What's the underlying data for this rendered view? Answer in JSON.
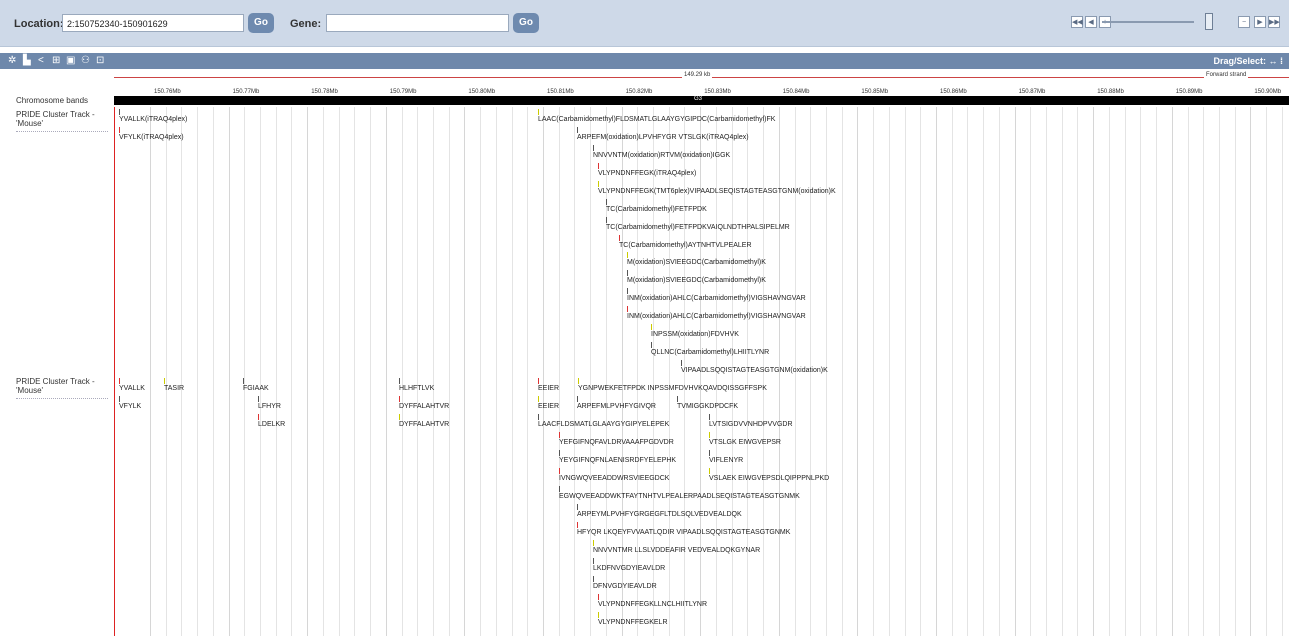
{
  "location": {
    "label": "Location:",
    "value": "2:150752340-150901629"
  },
  "gene": {
    "label": "Gene:",
    "value": ""
  },
  "go_label": "Go",
  "toolbar": {
    "drag_select": "Drag/Select: ↔ ⁞"
  },
  "ruler": {
    "span_label": "149.29 kb",
    "strand_label": "Forward strand",
    "ticks": [
      "150.76Mb",
      "150.77Mb",
      "150.78Mb",
      "150.79Mb",
      "150.80Mb",
      "150.81Mb",
      "150.82Mb",
      "150.83Mb",
      "150.84Mb",
      "150.85Mb",
      "150.86Mb",
      "150.87Mb",
      "150.88Mb",
      "150.89Mb",
      "150.90Mb"
    ]
  },
  "band": {
    "label": "Chromosome bands",
    "name": "G3"
  },
  "tracks": [
    {
      "label": "PRIDE Cluster Track - 'Mouse'"
    },
    {
      "label": "PRIDE Cluster Track - 'Mouse'"
    }
  ],
  "track1_features": [
    "YVALLK(iTRAQ4plex)",
    "VFYLK(iTRAQ4plex)",
    "LAAC(Carbamidomethyl)FLDSMATLGLAAYGYGIPDC(Carbamidomethyl)FK",
    "ARPEFM(oxidation)LPVHFYGR  VTSLGK(iTRAQ4plex)",
    "NNVVNTM(oxidation)RTVM(oxidation)IGGK",
    "VLYPNDNFFEGK(iTRAQ4plex)",
    "VLYPNDNFFEGK(TMT6plex)VIPAADLSEQISTAGTEASGTGNM(oxidation)K",
    "TC(Carbamidomethyl)FETFPDK",
    "TC(Carbamidomethyl)FETFPDKVAIQLNDTHPALSIPELMR",
    "TC(Carbamidomethyl)AYTNHTVLPEALER",
    "M(oxidation)SVIEEGDC(Carbamidomethyl)K",
    "M(oxidation)SVIEEGDC(Carbamidomethyl)K",
    "INM(oxidation)AHLC(Carbamidomethyl)VIGSHAVNGVAR",
    "INM(oxidation)AHLC(Carbamidomethyl)VIGSHAVNGVAR",
    "INPSSM(oxidation)FDVHVK",
    "QLLNC(Carbamidomethyl)LHIITLYNR",
    "VIPAADLSQQISTAGTEASGTGNM(oxidation)K"
  ],
  "track2_features": [
    "YVALLK",
    "TASIR",
    "FGIAAK",
    "HLHFTLVK",
    "EEIER",
    "YGNPWEKFETFPDK INPSSMFDVHVKQAVDQISSGFFSPK",
    "VFYLK",
    "LFHYR",
    "DYFFALAHTVR",
    "EEIER",
    "ARPEFMLPVHFYGIVQR",
    "TVMIGGKDPDCFK",
    "LDELKR",
    "DYFFALAHTVR",
    "LAACFLDSMATLGLAAYGYGIPYELEPEK",
    "LVTSIGDVVNHDPVVGDR",
    "YEFGIFNQFAVLDRVAAAFPGDVDR",
    "VTSLGK EIWGVEPSR",
    "YEYGIFNQFNLAENISRDFYELEPHK",
    "VIFLENYR",
    "IVNGWQVEEADDWRSVIEEGDCK",
    "VSLAEK EIWGVEPSDLQIPPPNLPKD",
    "EGWQVEEADDWKTFAYTNHTVLPEALERPAADLSEQISTAGTEASGTGNMK",
    "ARPEYMLPVHFYGRGEGFLTDLSQLVEDVEALDQK",
    "HFYQR  LKQEYFVVAATLQDIR  VIPAADLSQQISTAGTEASGTGNMK",
    "NNVVNTMR  LLSLVDDEAFIR VEDVEALDQKGYNAR",
    "LKDFNVGDYIEAVLDR",
    "DFNVGDYIEAVLDR",
    "VLYPNDNFFEGKLLNCLHIITLYNR",
    "VLYPNDNFFEGKELR"
  ]
}
